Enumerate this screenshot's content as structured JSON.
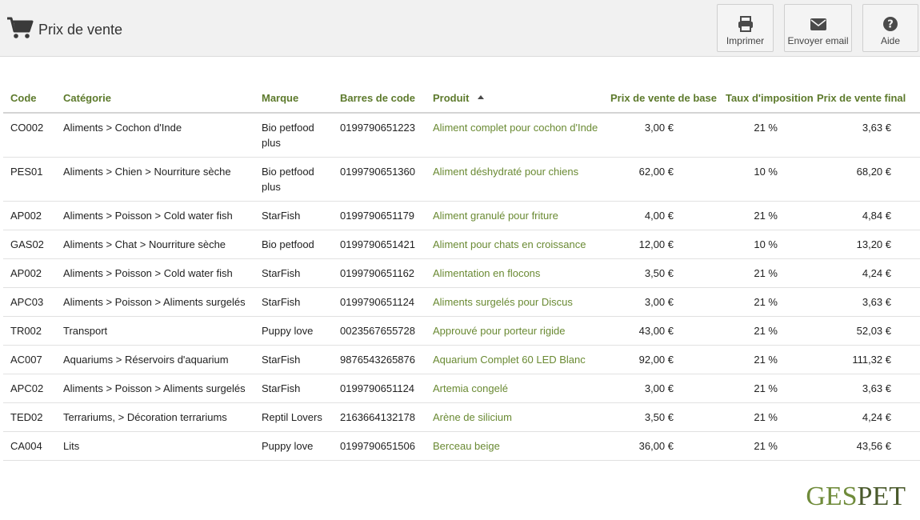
{
  "header": {
    "title": "Prix de vente",
    "buttons": {
      "print": "Imprimer",
      "email": "Envoyer email",
      "help": "Aide"
    }
  },
  "colors": {
    "accent": "#5d7a2c",
    "link": "#6a8a33",
    "topbar": "#f1f1f1"
  },
  "table": {
    "columns": [
      "Code",
      "Catégorie",
      "Marque",
      "Barres de code",
      "Produit",
      "Prix de vente de base",
      "Taux  d'imposition",
      "Prix de vente final"
    ],
    "sorted_column": "Produit",
    "sort_direction": "ascending",
    "rows": [
      [
        "CO002",
        "Aliments > Cochon d'Inde",
        "Bio petfood plus",
        "0199790651223",
        "Aliment complet pour cochon d'Inde",
        "3,00 €",
        "21 %",
        "3,63 €"
      ],
      [
        "PES01",
        "Aliments > Chien > Nourriture sèche",
        "Bio petfood plus",
        "0199790651360",
        "Aliment déshydraté pour chiens",
        "62,00 €",
        "10 %",
        "68,20 €"
      ],
      [
        "AP002",
        "Aliments > Poisson > Cold water fish",
        "StarFish",
        "0199790651179",
        "Aliment granulé pour friture",
        "4,00 €",
        "21 %",
        "4,84 €"
      ],
      [
        "GAS02",
        "Aliments > Chat > Nourriture sèche",
        "Bio petfood",
        "0199790651421",
        "Aliment pour chats en croissance",
        "12,00 €",
        "10 %",
        "13,20 €"
      ],
      [
        "AP002",
        "Aliments > Poisson > Cold water fish",
        "StarFish",
        "0199790651162",
        "Alimentation en flocons",
        "3,50 €",
        "21 %",
        "4,24 €"
      ],
      [
        "APC03",
        "Aliments > Poisson > Aliments surgelés",
        "StarFish",
        "0199790651124",
        "Aliments surgelés pour Discus",
        "3,00 €",
        "21 %",
        "3,63 €"
      ],
      [
        "TR002",
        "Transport",
        "Puppy love",
        "0023567655728",
        "Approuvé pour porteur rigide",
        "43,00 €",
        "21 %",
        "52,03 €"
      ],
      [
        "AC007",
        "Aquariums > Réservoirs d'aquarium",
        "StarFish",
        "9876543265876",
        "Aquarium Complet 60 LED Blanc",
        "92,00 €",
        "21 %",
        "111,32 €"
      ],
      [
        "APC02",
        "Aliments > Poisson > Aliments surgelés",
        "StarFish",
        "0199790651124",
        "Artemia congelé",
        "3,00 €",
        "21 %",
        "3,63 €"
      ],
      [
        "TED02",
        "Terrariums, > Décoration terrariums",
        "Reptil Lovers",
        "2163664132178",
        "Arène de silicium",
        "3,50 €",
        "21 %",
        "4,24 €"
      ],
      [
        "CA004",
        "Lits",
        "Puppy love",
        "0199790651506",
        "Berceau beige",
        "36,00 €",
        "21 %",
        "43,56 €"
      ]
    ]
  },
  "logo": {
    "part1": "GES",
    "part2": "PET"
  }
}
